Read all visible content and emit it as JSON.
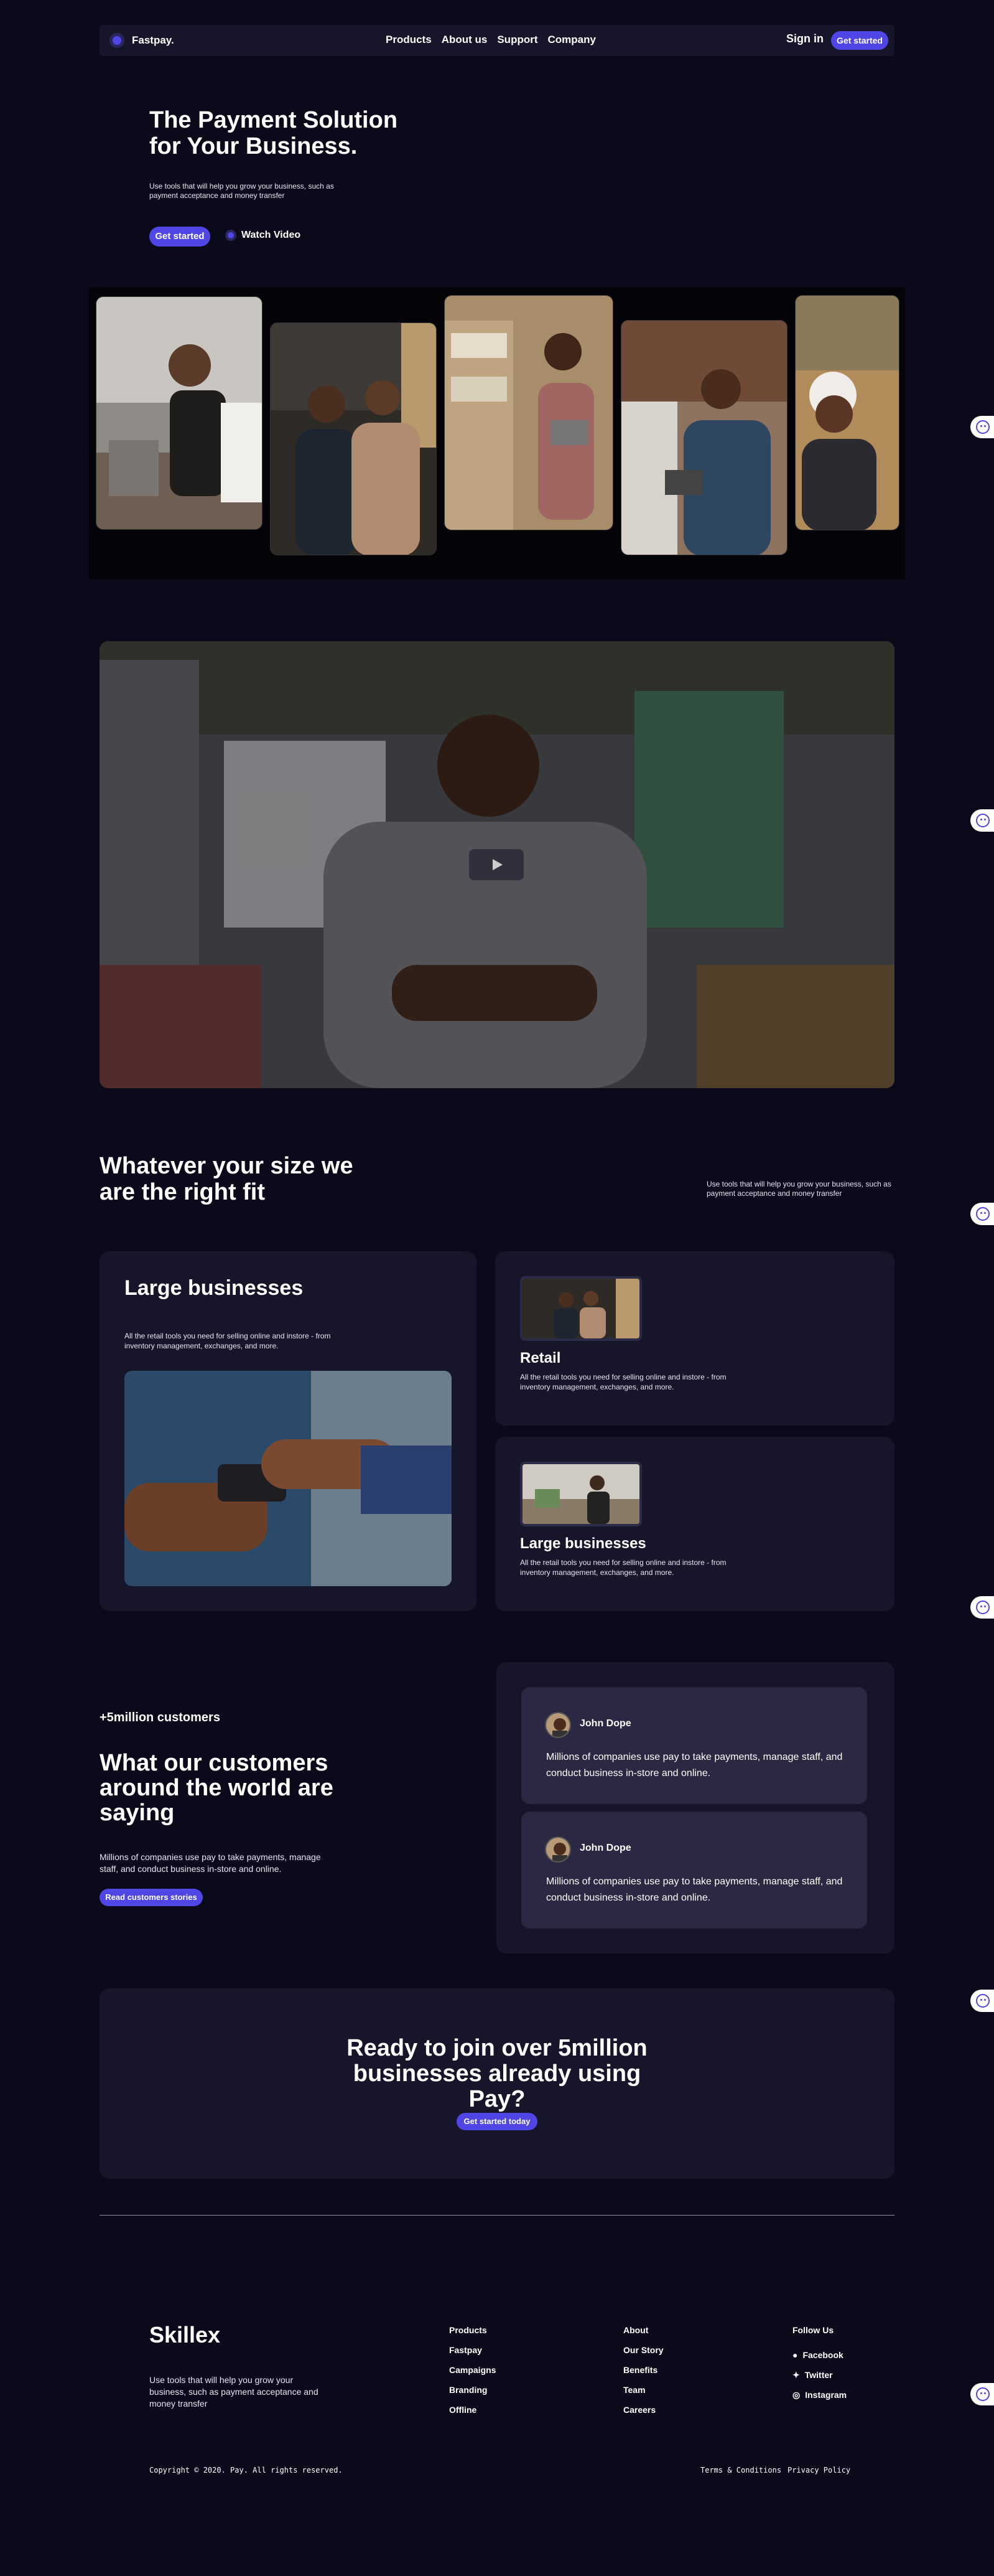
{
  "nav": {
    "brand": "Fastpay.",
    "links": [
      "Products",
      "About us",
      "Support",
      "Company"
    ],
    "sign_in": "Sign in",
    "cta": "Get started"
  },
  "hero": {
    "title_line1": "The Payment Solution",
    "title_line2": "for Your Business.",
    "subtitle": "Use tools that will help you grow your business, such as payment acceptance and money transfer",
    "cta": "Get started",
    "watch": "Watch Video"
  },
  "fit": {
    "title": "Whatever your size we are the right fit",
    "subtitle": "Use tools that will help you grow your business, such as payment acceptance and money transfer"
  },
  "segments": {
    "large": {
      "title": "Large businesses",
      "text": "All the retail tools you need for selling online and instore - from inventory management, exchanges, and more."
    },
    "retail": {
      "title": "Retail",
      "text": "All the retail tools you need for selling online and instore - from inventory management, exchanges, and more."
    },
    "large2": {
      "title": "Large businesses",
      "text": "All the retail tools you need for selling online and instore - from inventory management, exchanges, and more."
    }
  },
  "customers": {
    "count": "+5million customers",
    "title": "What our customers around the world are saying",
    "subtitle": "Millions of companies use pay to take payments, manage staff, and conduct business in-store and online.",
    "cta": "Read customers stories",
    "testimonials": [
      {
        "name": "John Dope",
        "quote": "Millions of companies use pay to take payments, manage staff, and conduct business in-store and online."
      },
      {
        "name": "John Dope",
        "quote": "Millions of companies use pay to take payments, manage staff, and conduct business in-store and online."
      }
    ]
  },
  "cta": {
    "title": "Ready to join over 5million businesses already using Pay?",
    "button": "Get started today"
  },
  "footer": {
    "brand": "Skillex",
    "subtitle": "Use tools that will help you grow your business, such as payment acceptance and money transfer",
    "col1": [
      "Products",
      "Fastpay",
      "Campaigns",
      "Branding",
      "Offline"
    ],
    "col2": [
      "About",
      "Our Story",
      "Benefits",
      "Team",
      "Careers"
    ],
    "follow_title": "Follow Us",
    "social": [
      "Facebook",
      "Twitter",
      "Instagram"
    ],
    "copyright": "Copyright © 2020. Pay. All rights reserved.",
    "terms": "Terms & Conditions",
    "privacy": "Privacy Policy"
  },
  "colors": {
    "background": "#0a0a1b",
    "panel": "#16152a",
    "accent": "#4f46e5",
    "card": "#2b2843"
  }
}
